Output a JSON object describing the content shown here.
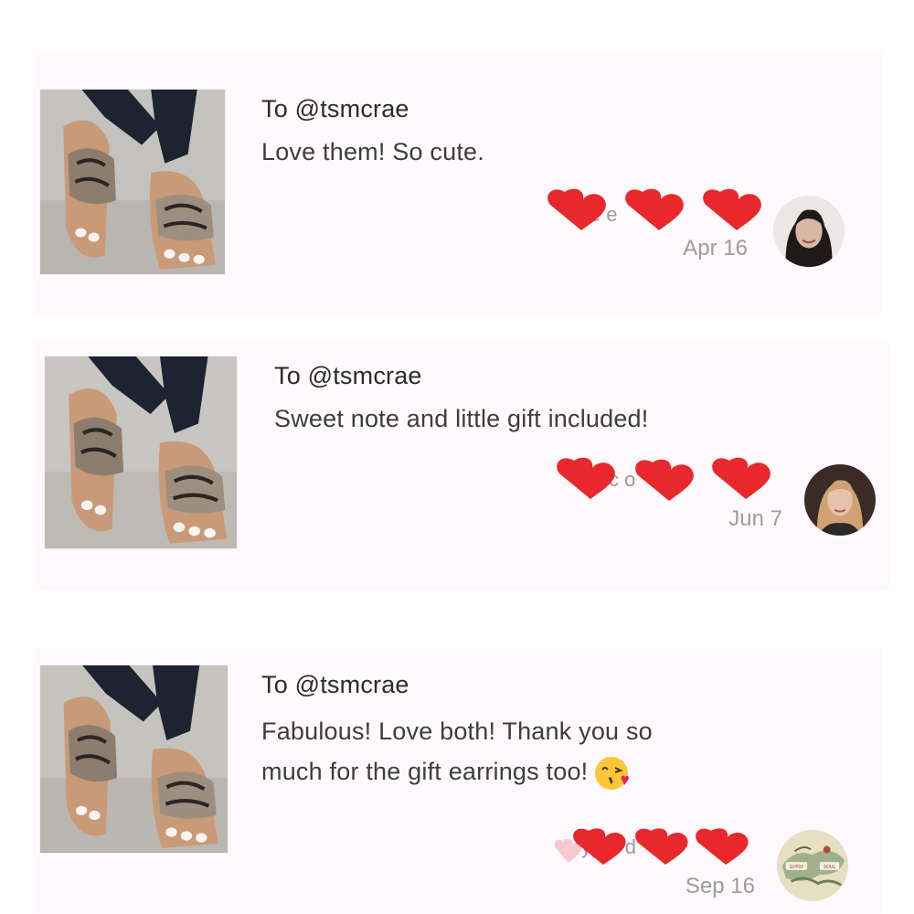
{
  "reviews": [
    {
      "recipient": "To @tsmcrae",
      "message": "Love them! So cute.",
      "sender_fragment": "ie e",
      "date": "Apr 16"
    },
    {
      "recipient": "To @tsmcrae",
      "message": "Sweet note and little gift included!",
      "sender_fragment": "c o",
      "date": "Jun 7"
    },
    {
      "recipient": "To @tsmcrae",
      "message_line1": "Fabulous! Love both! Thank you so",
      "message_line2": "much for the gift earrings too!",
      "sender_fragment": "yp o d",
      "date": "Sep 16",
      "avatar_text": [
        "GYPSY",
        "SOUL"
      ]
    }
  ],
  "colors": {
    "card_background": "#fdf9fc",
    "heart_red": "#e8282c",
    "heart_faded": "#f6c9d2",
    "date_gray": "#9c9c9c"
  },
  "icons": {
    "redaction": "heart-icon",
    "message_emoji": "face-blowing-kiss-emoji"
  }
}
